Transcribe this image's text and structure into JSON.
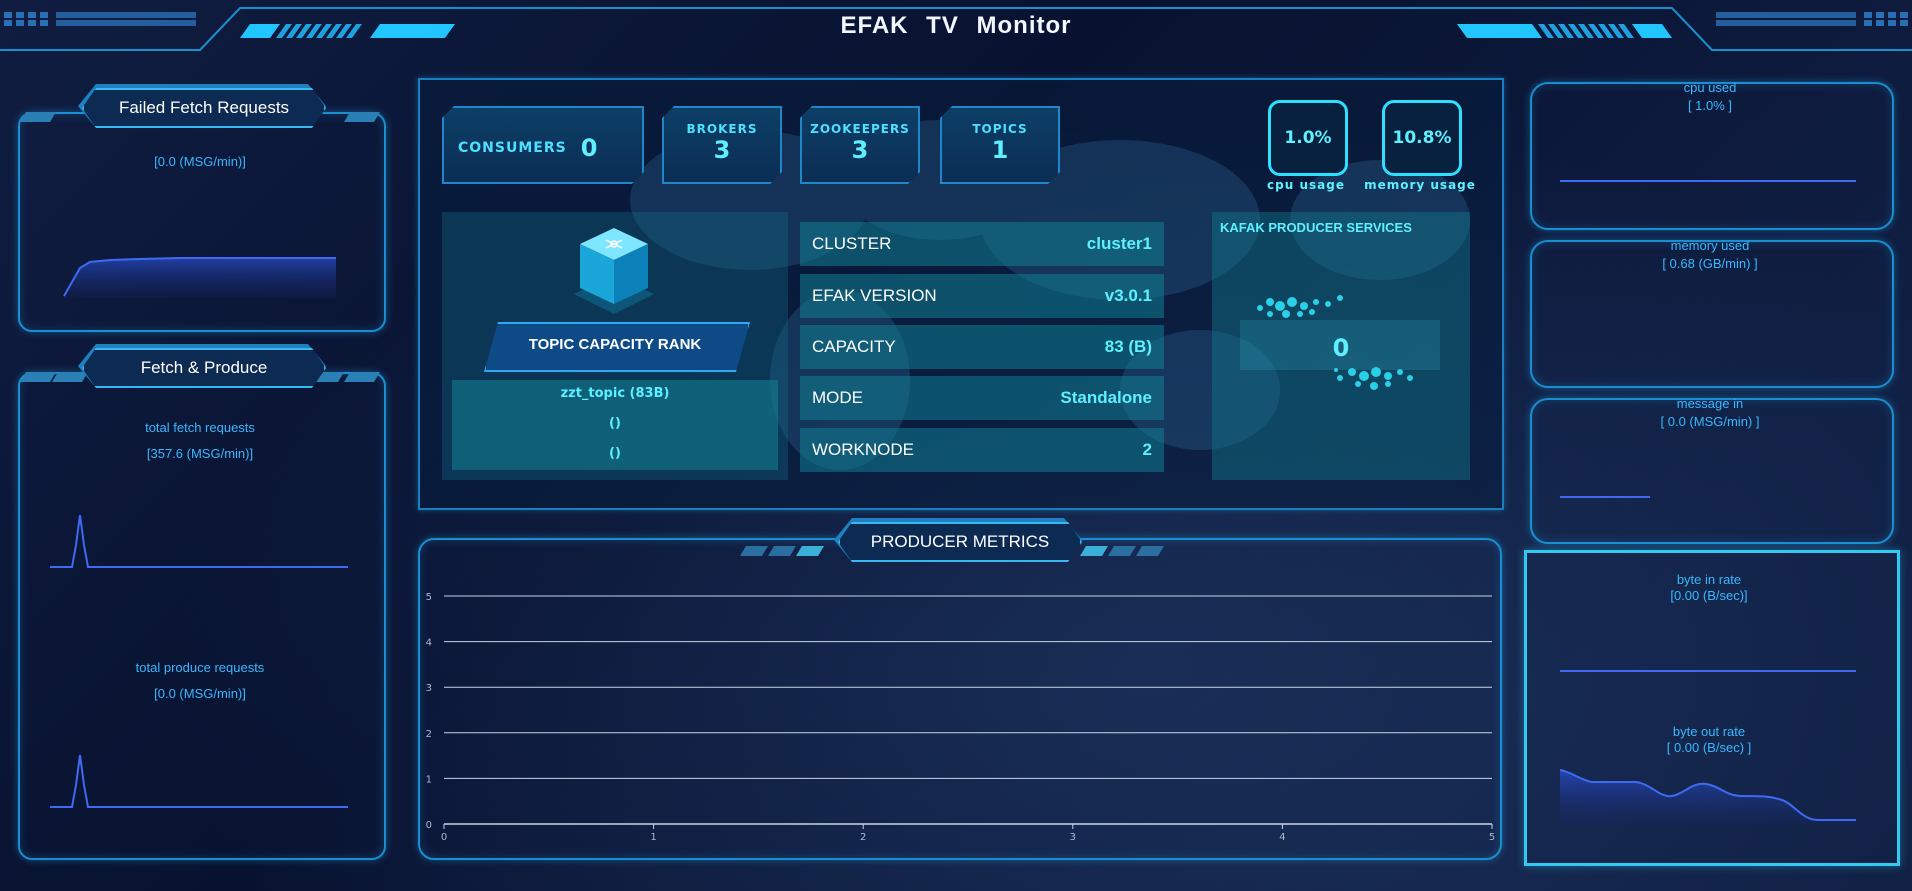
{
  "header": {
    "title": "EFAK  TV  Monitor"
  },
  "left_panels": {
    "failed_fetch": {
      "title": "Failed Fetch Requests",
      "value": "[0.0 (MSG/min)]"
    },
    "fetch_produce": {
      "title": "Fetch & Produce",
      "fetch_label": "total fetch requests",
      "fetch_value": "[357.6 (MSG/min)]",
      "produce_label": "total produce requests",
      "produce_value": "[0.0 (MSG/min)]"
    }
  },
  "stats": {
    "consumers": {
      "label": "CONSUMERS",
      "value": "0"
    },
    "brokers": {
      "label": "BROKERS",
      "value": "3"
    },
    "zookeepers": {
      "label": "ZOOKEEPERS",
      "value": "3"
    },
    "topics": {
      "label": "TOPICS",
      "value": "1"
    }
  },
  "usage": {
    "cpu": {
      "value": "1.0%",
      "label": "cpu usage"
    },
    "memory": {
      "value": "10.8%",
      "label": "memory usage"
    }
  },
  "topic_rank": {
    "title": "TOPIC CAPACITY RANK",
    "items": [
      "zzt_topic (83B)",
      "()",
      "()"
    ]
  },
  "cluster_info": [
    {
      "key": "CLUSTER",
      "value": "cluster1"
    },
    {
      "key": "EFAK VERSION",
      "value": "v3.0.1"
    },
    {
      "key": "CAPACITY",
      "value": "83 (B)"
    },
    {
      "key": "MODE",
      "value": "Standalone"
    },
    {
      "key": "WORKNODE",
      "value": "2"
    }
  ],
  "producer_services": {
    "title": "KAFAK PRODUCER SERVICES",
    "value": "0"
  },
  "producer_metrics": {
    "title": "PRODUCER METRICS",
    "y_ticks": [
      "5",
      "4",
      "3",
      "2",
      "1",
      "0"
    ],
    "x_ticks": [
      "0",
      "1",
      "2",
      "3",
      "4",
      "5"
    ]
  },
  "right_panels": {
    "cpu_used": {
      "label": "cpu used",
      "value": "[ 1.0% ]"
    },
    "memory_used": {
      "label": "memory used",
      "value": "[ 0.68 (GB/min) ]"
    },
    "message_in": {
      "label": "message in",
      "value": "[ 0.0 (MSG/min) ]"
    },
    "byte_in": {
      "label": "byte in rate",
      "value": "[0.00 (B/sec)]"
    },
    "byte_out": {
      "label": "byte out rate",
      "value": "[ 0.00 (B/sec) ]"
    }
  },
  "colors": {
    "accent": "#36c8ff",
    "background": "#07112e",
    "teal": "#5ef0ff"
  }
}
